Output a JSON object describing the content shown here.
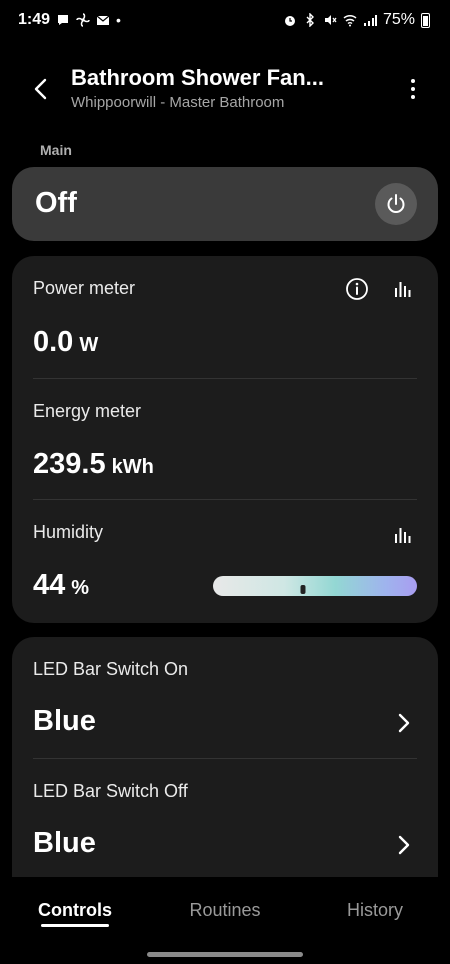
{
  "status_bar": {
    "time": "1:49",
    "dot": "•",
    "battery_percent": "75%",
    "left_icons": [
      "chat-icon",
      "fan-icon",
      "mail-icon"
    ],
    "right_icons": [
      "alarm-icon",
      "bluetooth-icon",
      "mute-icon",
      "wifi-icon",
      "signal-icon",
      "battery-icon"
    ]
  },
  "header": {
    "title": "Bathroom Shower Fan...",
    "subtitle": "Whippoorwill - Master Bathroom"
  },
  "main": {
    "section_label": "Main",
    "power_state": "Off"
  },
  "meters": {
    "power": {
      "label": "Power meter",
      "value": "0.0",
      "unit": "W"
    },
    "energy": {
      "label": "Energy meter",
      "value": "239.5",
      "unit": "kWh"
    },
    "humidity": {
      "label": "Humidity",
      "value": "44",
      "unit": "%",
      "level": 0.44
    }
  },
  "led": {
    "switch_on": {
      "label": "LED Bar Switch On",
      "value": "Blue"
    },
    "switch_off": {
      "label": "LED Bar Switch Off",
      "value": "Blue"
    }
  },
  "tabs": [
    {
      "label": "Controls",
      "active": true
    },
    {
      "label": "Routines",
      "active": false
    },
    {
      "label": "History",
      "active": false
    }
  ],
  "colors": {
    "power_card": "#3a3a3a",
    "card": "#1c1c1c",
    "background": "#000000"
  }
}
